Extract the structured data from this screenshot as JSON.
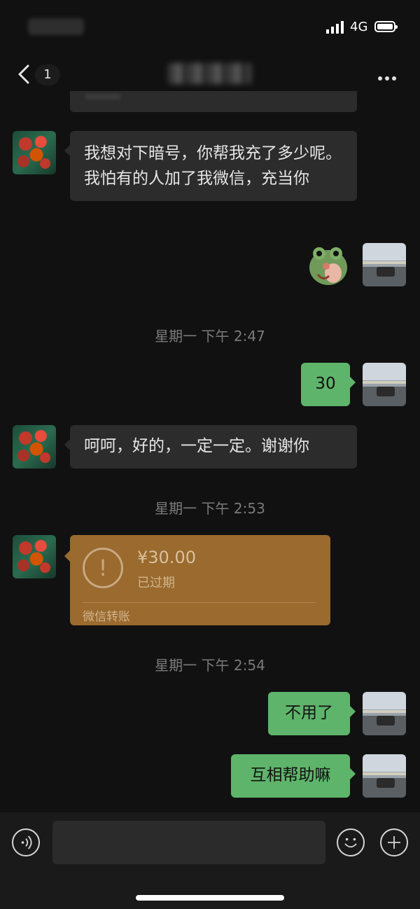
{
  "status_bar": {
    "network": "4G",
    "battery_icon": "battery-icon",
    "signal_icon": "signal-icon"
  },
  "nav": {
    "unread_count": "1",
    "back_icon": "chevron-left-icon",
    "more_icon": "more-dots-icon"
  },
  "messages": [
    {
      "side": "in",
      "text": "我想对下暗号，你帮我充了多少呢。我怕有的人加了我微信，充当你"
    },
    {
      "side": "out",
      "type": "sticker",
      "sticker_icon": "frog-sticker-icon"
    },
    {
      "type": "timestamp",
      "text": "星期一 下午 2:47"
    },
    {
      "side": "out",
      "text": "30"
    },
    {
      "side": "in",
      "text": "呵呵，好的，一定一定。谢谢你"
    },
    {
      "type": "timestamp",
      "text": "星期一 下午 2:53"
    },
    {
      "side": "in",
      "type": "transfer",
      "amount": "¥30.00",
      "status": "已过期",
      "label": "微信转账"
    },
    {
      "type": "timestamp",
      "text": "星期一 下午 2:54"
    },
    {
      "side": "out",
      "text": "不用了"
    },
    {
      "side": "out",
      "text": "互相帮助嘛"
    }
  ],
  "input_bar": {
    "voice_icon": "voice-icon",
    "emoji_icon": "emoji-icon",
    "plus_icon": "plus-icon"
  },
  "colors": {
    "background": "#111111",
    "incoming_bubble": "#2c2c2c",
    "outgoing_bubble": "#5fb46b",
    "transfer_card": "#9a6a2e"
  }
}
